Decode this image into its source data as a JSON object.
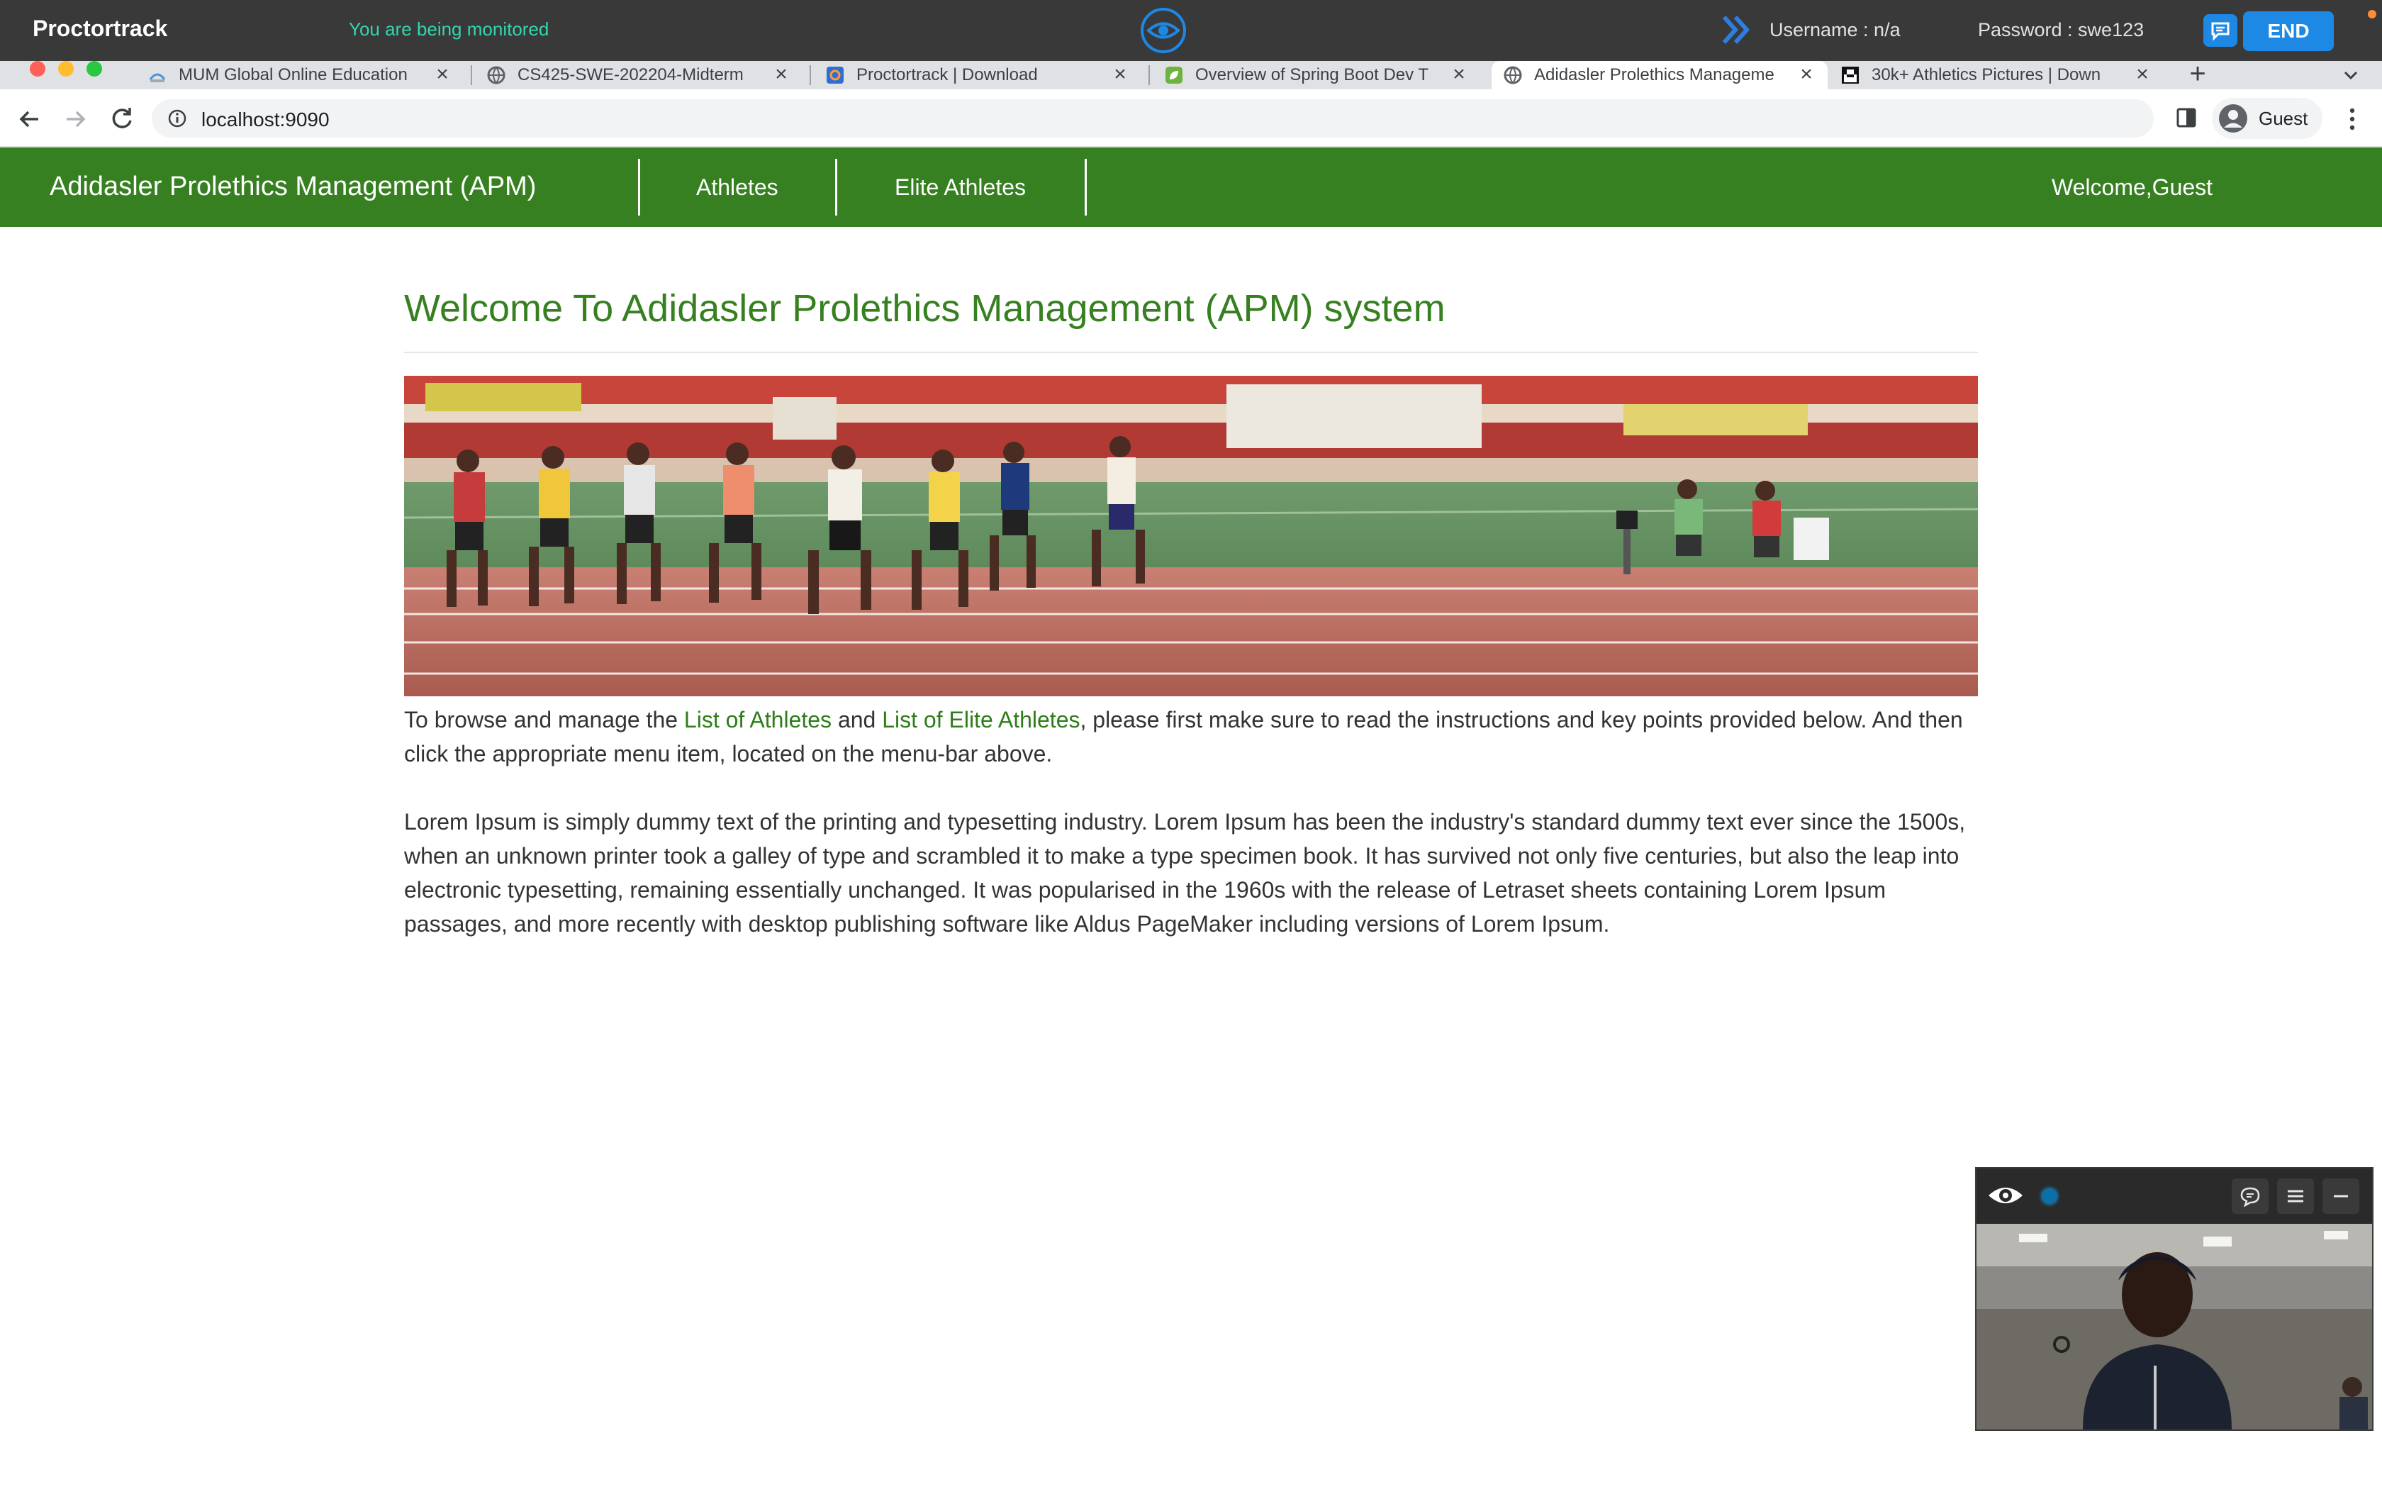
{
  "proctortrack": {
    "brand": "Proctortrack",
    "monitoring_text": "You are being monitored",
    "username": "Username : n/a",
    "password": "Password : swe123",
    "end_label": "END",
    "colors": {
      "bar": "#393939",
      "monitor_text": "#33d6ae",
      "button": "#1e88e5"
    }
  },
  "browser": {
    "tabs": [
      {
        "title": "MUM Global Online Education",
        "icon": "mum-favicon"
      },
      {
        "title": "CS425-SWE-202204-Midterm",
        "icon": "globe-icon"
      },
      {
        "title": "Proctortrack | Download",
        "icon": "proctortrack-favicon"
      },
      {
        "title": "Overview of Spring Boot Dev T",
        "icon": "spring-favicon"
      },
      {
        "title": "Adidasler Prolethics Manageme",
        "icon": "globe-icon",
        "active": true
      },
      {
        "title": "30k+ Athletics Pictures | Down",
        "icon": "unsplash-favicon"
      }
    ],
    "url": "localhost:9090",
    "profile_label": "Guest"
  },
  "app": {
    "brand": "Adidasler Prolethics Management (APM)",
    "nav": [
      "Athletes",
      "Elite Athletes"
    ],
    "welcome": "Welcome,Guest",
    "accent_color": "#378021"
  },
  "page": {
    "title": "Welcome To Adidasler Prolethics Management (APM) system",
    "intro": {
      "before": "To browse and manage the ",
      "link1": "List of Athletes",
      "middle": " and ",
      "link2": "List of Elite Athletes",
      "after": ", please first make sure to read the instructions and key points provided below. And then click the appropriate menu item, located on the menu-bar above."
    },
    "lorem": "Lorem Ipsum is simply dummy text of the printing and typesetting industry. Lorem Ipsum has been the industry's standard dummy text ever since the 1500s, when an unknown printer took a galley of type and scrambled it to make a type specimen book. It has survived not only five centuries, but also the leap into electronic typesetting, remaining essentially unchanged. It was popularised in the 1960s with the release of Letraset sheets containing Lorem Ipsum passages, and more recently with desktop publishing software like Aldus PageMaker including versions of Lorem Ipsum."
  }
}
